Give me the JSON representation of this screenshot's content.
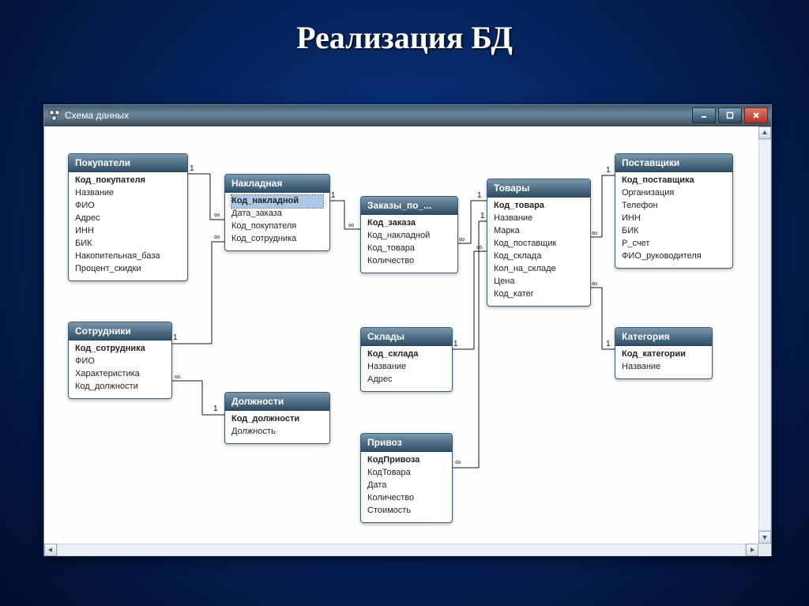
{
  "slide_title": "Реализация БД",
  "window_title": "Схема данных",
  "rel_one": "1",
  "rel_many": "∞",
  "tables": {
    "pokupateli": {
      "title": "Покупатели",
      "fields": [
        "Код_покупателя",
        "Название",
        "ФИО",
        "Адрес",
        "ИНН",
        "БИК",
        "Накопительная_база",
        "Процент_скидки"
      ]
    },
    "sotrudniki": {
      "title": "Сотрудники",
      "fields": [
        "Код_сотрудника",
        "ФИО",
        "Характеристика",
        "Код_должности"
      ]
    },
    "nakladnaya": {
      "title": "Накладная",
      "fields": [
        "Код_накладной",
        "Дата_заказа",
        "Код_покупателя",
        "Код_сотрудника"
      ]
    },
    "dolzhnosti": {
      "title": "Должности",
      "fields": [
        "Код_должности",
        "Должность"
      ]
    },
    "zakazy": {
      "title": "Заказы_по_...",
      "fields": [
        "Код_заказа",
        "Код_накладной",
        "Код_товара",
        "Количество"
      ]
    },
    "sklady": {
      "title": "Склады",
      "fields": [
        "Код_склада",
        "Название",
        "Адрес"
      ]
    },
    "privoz": {
      "title": "Привоз",
      "fields": [
        "КодПривоза",
        "КодТовара",
        "Дата",
        "Количество",
        "Стоимость"
      ]
    },
    "tovary": {
      "title": "Товары",
      "fields": [
        "Код_товара",
        "Название",
        "Марка",
        "Код_поставщик",
        "Код_склада",
        "Кол_на_складе",
        "Цена",
        "Код_катег"
      ]
    },
    "postavshiki": {
      "title": "Поставщики",
      "fields": [
        "Код_поставщика",
        "Организация",
        "Телефон",
        "ИНН",
        "БИК",
        "Р_счет",
        "ФИО_руководителя"
      ]
    },
    "kategoriya": {
      "title": "Категория",
      "fields": [
        "Код_категории",
        "Название"
      ]
    }
  },
  "relationships": [
    {
      "from": "pokupateli.Код_покупателя",
      "to": "nakladnaya.Код_покупателя",
      "card": "1:∞"
    },
    {
      "from": "sotrudniki.Код_сотрудника",
      "to": "nakladnaya.Код_сотрудника",
      "card": "1:∞"
    },
    {
      "from": "nakladnaya.Код_накладной",
      "to": "zakazy.Код_накладной",
      "card": "1:∞"
    },
    {
      "from": "tovary.Код_товара",
      "to": "zakazy.Код_товара",
      "card": "1:∞"
    },
    {
      "from": "sklady.Код_склада",
      "to": "tovary.Код_склада",
      "card": "1:∞"
    },
    {
      "from": "postavshiki.Код_поставщика",
      "to": "tovary.Код_поставщик",
      "card": "1:∞"
    },
    {
      "from": "kategoriya.Код_категории",
      "to": "tovary.Код_катег",
      "card": "1:∞"
    },
    {
      "from": "dolzhnosti.Код_должности",
      "to": "sotrudniki.Код_должности",
      "card": "1:∞"
    },
    {
      "from": "tovary.Код_товара",
      "to": "privoz.КодТовара",
      "card": "1:∞"
    }
  ]
}
